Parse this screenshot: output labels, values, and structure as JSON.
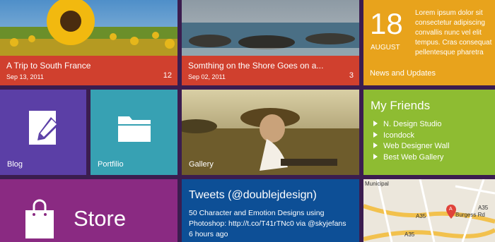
{
  "tiles": {
    "france": {
      "title": "A Trip to South France",
      "date": "Sep 13, 2011",
      "count": "12"
    },
    "shore": {
      "title": "Somthing on the Shore Goes on a...",
      "date": "Sep 02, 2011",
      "count": "3"
    },
    "news": {
      "day": "18",
      "month": "AUGUST",
      "body": "Lorem ipsum dolor sit consectetur adipiscing convallis nunc vel elit tempus. Cras consequat pellentesque pharetra",
      "label": "News and Updates"
    },
    "blog": {
      "label": "Blog"
    },
    "portfolio": {
      "label": "Portfilio"
    },
    "gallery": {
      "label": "Gallery"
    },
    "friends": {
      "title": "My Friends",
      "items": [
        "N. Design Studio",
        "Icondock",
        "Web Designer Wall",
        "Best Web Gallery"
      ]
    },
    "store": {
      "label": "Store"
    },
    "tweets": {
      "title": "Tweets (@doublejdesign)",
      "body": "50 Character and Emotion Designs using Photoshop: http://t.co/T41rTNc0 via @skyjefans 6 hours ago"
    },
    "map": {
      "labels": [
        "Municipal",
        "A35",
        "A35",
        "A35",
        "Burgess Rd",
        "A"
      ]
    }
  },
  "colors": {
    "background": "#3b1d4f",
    "red": "#d0402e",
    "orange": "#e8a31c",
    "blue_purple": "#5b3fa6",
    "teal": "#37a1b3",
    "green": "#8ebc32",
    "magenta": "#8a2a82",
    "blue": "#0d4f96"
  },
  "icons": [
    "pencil-document-icon",
    "folder-icon",
    "shopping-bag-icon",
    "map-marker-icon"
  ]
}
